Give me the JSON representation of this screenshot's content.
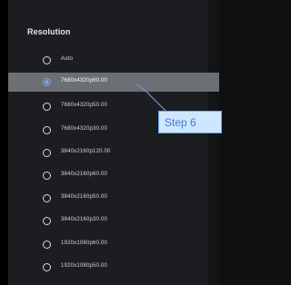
{
  "panel": {
    "title": "Resolution",
    "options": [
      {
        "label": "Auto",
        "selected": false
      },
      {
        "label": "7680x4320p60.00",
        "selected": true
      },
      {
        "label": "7680x4320p50.00",
        "selected": false
      },
      {
        "label": "7680x4320p30.00",
        "selected": false
      },
      {
        "label": "3840x2160p120.00",
        "selected": false
      },
      {
        "label": "3840x2160p60.00",
        "selected": false
      },
      {
        "label": "3840x2160p50.00",
        "selected": false
      },
      {
        "label": "3840x2160p30.00",
        "selected": false
      },
      {
        "label": "1920x1080p60.00",
        "selected": false
      },
      {
        "label": "1920x1080p50.00",
        "selected": false
      }
    ]
  },
  "callout": {
    "label": "Step 6"
  },
  "colors": {
    "selected_row": "#6c6f74",
    "callout_border": "#6fa8e8",
    "radio_checked": "#7fa4e6"
  }
}
